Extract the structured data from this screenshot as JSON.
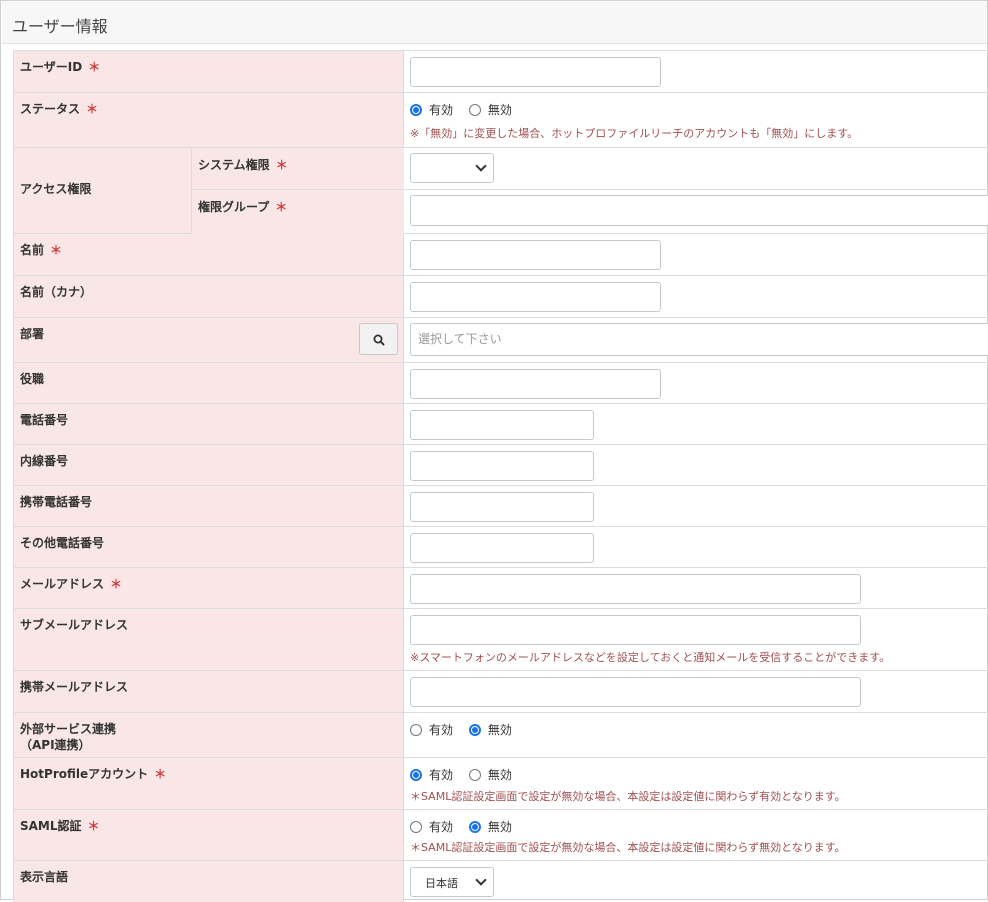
{
  "header": {
    "title": "ユーザー情報"
  },
  "required_mark": "＊",
  "fields": {
    "user_id": {
      "label": "ユーザーID",
      "value": ""
    },
    "status": {
      "label": "ステータス",
      "options": [
        "有効",
        "無効"
      ],
      "selected": "有効",
      "note": "※「無効」に変更した場合、ホットプロファイルリーチのアカウントも「無効」にします。"
    },
    "access": {
      "label": "アクセス権限",
      "system_auth_label": "システム権限",
      "system_auth_value": "",
      "auth_group_label": "権限グループ",
      "auth_group_value": ""
    },
    "name": {
      "label": "名前",
      "value": ""
    },
    "name_kana": {
      "label": "名前（カナ）",
      "value": ""
    },
    "department": {
      "label": "部署",
      "placeholder": "選択して下さい"
    },
    "position": {
      "label": "役職",
      "value": ""
    },
    "phone": {
      "label": "電話番号",
      "value": ""
    },
    "extension": {
      "label": "内線番号",
      "value": ""
    },
    "mobile_phone": {
      "label": "携帯電話番号",
      "value": ""
    },
    "other_phone": {
      "label": "その他電話番号",
      "value": ""
    },
    "email": {
      "label": "メールアドレス",
      "value": ""
    },
    "sub_email": {
      "label": "サブメールアドレス",
      "value": "",
      "note": "※スマートフォンのメールアドレスなどを設定しておくと通知メールを受信することができます。"
    },
    "mobile_email": {
      "label": "携帯メールアドレス",
      "value": ""
    },
    "external_service": {
      "label_line1": "外部サービス連携",
      "label_line2": "（API連携）",
      "options": [
        "有効",
        "無効"
      ],
      "selected": "無効"
    },
    "hotprofile_account": {
      "label": "HotProfileアカウント",
      "options": [
        "有効",
        "無効"
      ],
      "selected": "有効",
      "note": "＊SAML認証設定画面で設定が無効な場合、本設定は設定値に関わらず有効となります。"
    },
    "saml": {
      "label": "SAML認証",
      "options": [
        "有効",
        "無効"
      ],
      "selected": "無効",
      "note": "＊SAML認証設定画面で設定が無効な場合、本設定は設定値に関わらず無効となります。"
    },
    "language": {
      "label": "表示言語",
      "value": "日本語"
    }
  },
  "colors": {
    "label_bg": "#f9e6e6",
    "required": "#d04040",
    "note": "#a05050",
    "radio_on": "#1a73e8"
  },
  "icons": {
    "department_search": "search-icon",
    "dropdown": "chevron-down-icon"
  }
}
